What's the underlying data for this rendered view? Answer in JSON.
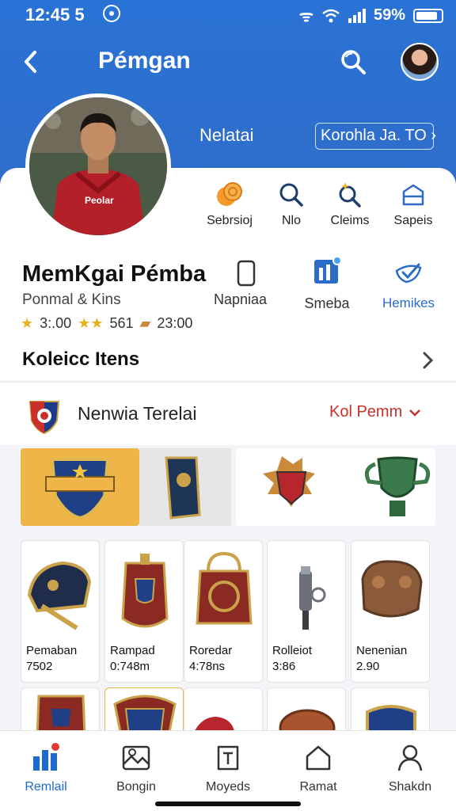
{
  "status": {
    "time": "12:45 5",
    "battery": "59%"
  },
  "topbar": {
    "title": "Pémgan"
  },
  "profile": {
    "nickname": "Nelatai",
    "follow_label": "Korohla Ja. TO"
  },
  "actions": [
    {
      "label": "Sebrsioj",
      "icon": "coins-icon"
    },
    {
      "label": "Nlo",
      "icon": "search-icon"
    },
    {
      "label": "Cleims",
      "icon": "magnify-sparkle-icon"
    },
    {
      "label": "Sapeis",
      "icon": "box-icon"
    }
  ],
  "user": {
    "name": "MemKgai Pémba",
    "subtitle": "Ponmal & Kins",
    "stat1": "3:.00",
    "stat2": "561",
    "stat3": "23:00"
  },
  "side_actions": {
    "phone_label": "Napniaa",
    "smeba_label": "Smeba",
    "hemikes_label": "Hemikes"
  },
  "section": {
    "title": "Koleicc Itens"
  },
  "filter": {
    "team": "Nenwia Terelai",
    "selected": "Kol Pemm"
  },
  "items": [
    {
      "name": "Pemaban",
      "price": "7502"
    },
    {
      "name": "Rampad",
      "price": "0:748m"
    },
    {
      "name": "Roredar",
      "price": "4:78ns"
    },
    {
      "name": "Rolleiot",
      "price": "3:86"
    },
    {
      "name": "Nenenian",
      "price": "2.90"
    }
  ],
  "nav": [
    {
      "label": "Remlail"
    },
    {
      "label": "Bongin"
    },
    {
      "label": "Moyeds"
    },
    {
      "label": "Ramat"
    },
    {
      "label": "Shakdn"
    }
  ]
}
